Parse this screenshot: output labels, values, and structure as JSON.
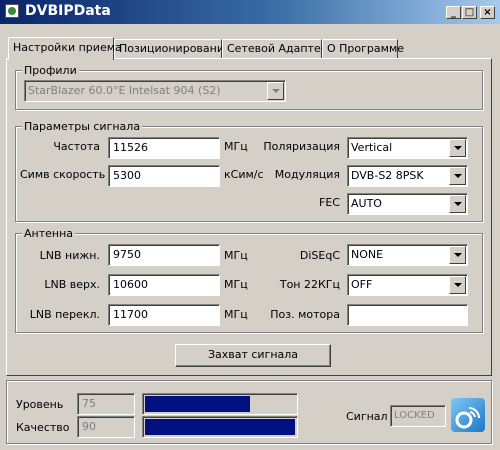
{
  "window": {
    "title": "DVBIPData",
    "controls": {
      "minimize": "_",
      "maximize": "□",
      "close": "×"
    }
  },
  "tabs": [
    {
      "label": "Настройки приема",
      "active": true
    },
    {
      "label": "Позиционирование",
      "active": false
    },
    {
      "label": "Сетевой Адаптер",
      "active": false
    },
    {
      "label": "О Программе",
      "active": false
    }
  ],
  "profiles": {
    "group_label": "Профили",
    "selected": "StarBlazer 60.0°E Intelsat 904 (S2)",
    "disabled": true
  },
  "signal_params": {
    "group_label": "Параметры сигнала",
    "frequency": {
      "label": "Частота",
      "value": "11526",
      "unit": "МГц"
    },
    "symbol_rate": {
      "label": "Симв скорость",
      "value": "5300",
      "unit": "кСим/с"
    },
    "polarization": {
      "label": "Поляризация",
      "value": "Vertical"
    },
    "modulation": {
      "label": "Модуляция",
      "value": "DVB-S2 8PSK"
    },
    "fec": {
      "label": "FEC",
      "value": "AUTO"
    }
  },
  "antenna": {
    "group_label": "Антенна",
    "lnb_low": {
      "label": "LNB нижн.",
      "value": "9750",
      "unit": "МГц"
    },
    "lnb_high": {
      "label": "LNB верх.",
      "value": "10600",
      "unit": "МГц"
    },
    "lnb_switch": {
      "label": "LNB перекл.",
      "value": "11700",
      "unit": "МГц"
    },
    "diseqc": {
      "label": "DiSEqC",
      "value": "NONE"
    },
    "tone22": {
      "label": "Тон 22КГц",
      "value": "OFF"
    },
    "motor_pos": {
      "label": "Поз. мотора",
      "value": ""
    }
  },
  "capture_button": "Захват сигнала",
  "status": {
    "level": {
      "label": "Уровень",
      "value": "75",
      "fraction": 0.75
    },
    "quality": {
      "label": "Качество",
      "value": "90",
      "fraction": 0.9
    },
    "signal": {
      "label": "Сигнал",
      "value": "LOCKED"
    }
  },
  "colors": {
    "title_start": "#0a246a",
    "title_end": "#a6caf0",
    "bar": "#001080",
    "face": "#d4d0c8",
    "signal_icon": "#1b77c7"
  },
  "icons": {
    "app": "app-icon",
    "signal": "signal-status-icon"
  }
}
